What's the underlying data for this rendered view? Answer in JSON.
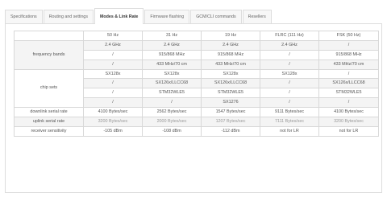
{
  "tabs": [
    {
      "label": "Specifications"
    },
    {
      "label": "Routing and settings"
    },
    {
      "label": "Modes & Link Rate",
      "active": true
    },
    {
      "label": "Firmware flashing"
    },
    {
      "label": "GCM/CLI commands"
    },
    {
      "label": "Resellers"
    }
  ],
  "table": {
    "columns": [
      "",
      "50 Hz",
      "31 Hz",
      "19 Hz",
      "FLRC (111 Hz)",
      "FSK (50 Hz)"
    ],
    "rows": [
      {
        "label": "",
        "cells": [
          "2.4 GHz",
          "2.4 GHz",
          "2.4 GHz",
          "2.4 GHz",
          "/"
        ]
      },
      {
        "label": "frequency bands",
        "cells": [
          "/",
          "915/868 MHz",
          "915/868 MHz",
          "/",
          "915/868 MHz"
        ]
      },
      {
        "label": "",
        "cells": [
          "/",
          "433 MHz/70 cm",
          "433 MHz/70 cm",
          "/",
          "433 MHz/70 cm"
        ]
      },
      {
        "label": "",
        "cells": [
          "SX128x",
          "SX128x",
          "SX128x",
          "SX128x",
          "/"
        ]
      },
      {
        "label": "chip sets",
        "cells": [
          "/",
          "SX126x/LLCC68",
          "SX126x/LLCC68",
          "/",
          "SX126x/LLCC68"
        ]
      },
      {
        "label": "",
        "cells": [
          "/",
          "STM32WLE5",
          "STM32WLE5",
          "/",
          "STM32WLE5"
        ]
      },
      {
        "label": "",
        "cells": [
          "/",
          "/",
          "SX1276",
          "/",
          "/"
        ]
      },
      {
        "label": "downlink serial rate",
        "cells": [
          "4100 Bytes/sec",
          "2562 Bytes/sec",
          "1547 Bytes/sec",
          "9111 Bytes/sec",
          "4100 Bytes/sec"
        ]
      },
      {
        "label": "uplink serial rate",
        "cells": [
          "3200 Bytes/sec",
          "2000 Bytes/sec",
          "1207 Bytes/sec",
          "7111 Bytes/sec",
          "3200 Bytes/sec"
        ]
      },
      {
        "label": "receiver sensitivity",
        "cells": [
          "-105 dBm",
          "-108 dBm",
          "-112 dBm",
          "not for LR",
          "not for LR"
        ]
      }
    ]
  }
}
